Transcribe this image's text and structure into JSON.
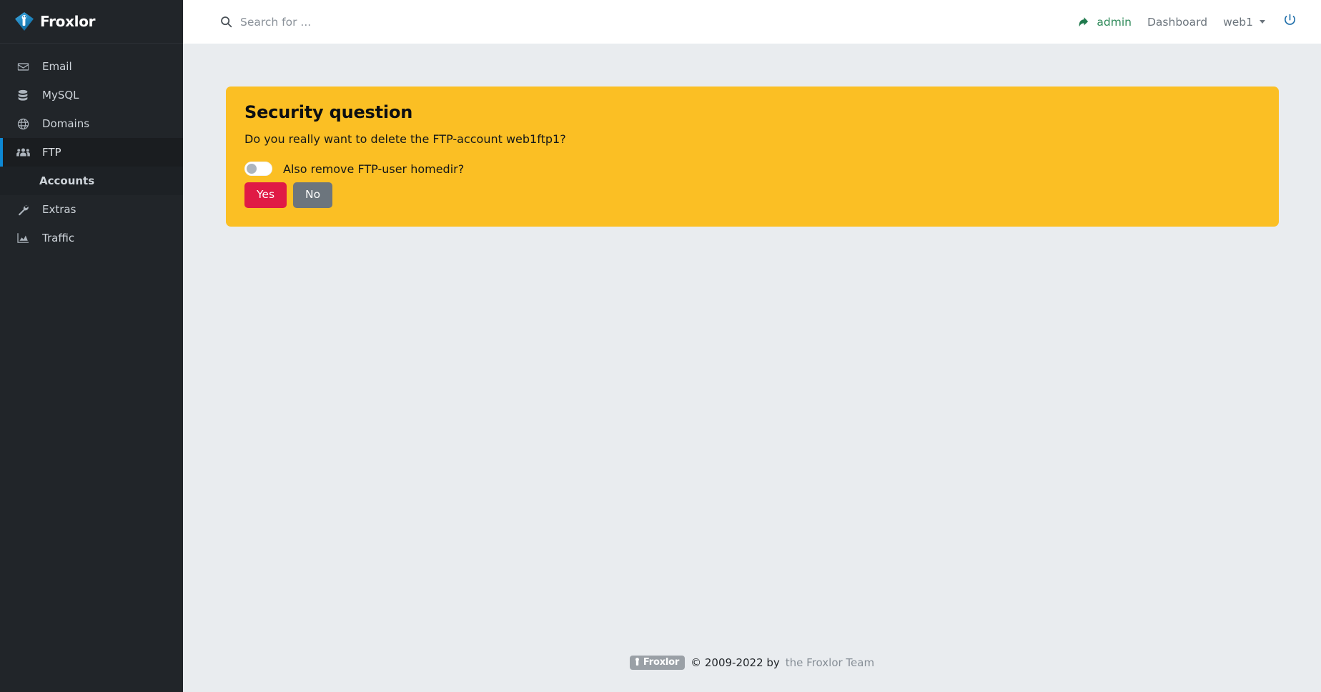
{
  "brand": {
    "name": "Froxlor",
    "logo_icon": "froxlor-wrench-logo",
    "accent_color": "#1b7fb8"
  },
  "sidebar": {
    "background_color": "#212529",
    "active_indicator_color": "#0d88d4",
    "items": [
      {
        "label": "Email",
        "icon": "envelope-icon",
        "active": false
      },
      {
        "label": "MySQL",
        "icon": "database-icon",
        "active": false
      },
      {
        "label": "Domains",
        "icon": "globe-icon",
        "active": false
      },
      {
        "label": "FTP",
        "icon": "users-icon",
        "active": true
      }
    ],
    "sub_item": {
      "label": "Accounts",
      "parent": "FTP"
    },
    "items_after": [
      {
        "label": "Extras",
        "icon": "wrench-icon",
        "active": false
      },
      {
        "label": "Traffic",
        "icon": "chart-icon",
        "active": false
      }
    ]
  },
  "topbar": {
    "search": {
      "icon": "search-icon",
      "placeholder": "Search for ...",
      "value": ""
    },
    "back_icon": "back-arrow-icon",
    "admin_label": "admin",
    "admin_color": "#2f8a5a",
    "dashboard_label": "Dashboard",
    "customer_label": "web1",
    "customer_caret_icon": "chevron-down-icon",
    "logout_icon": "power-icon",
    "logout_color": "#1b6ca8"
  },
  "panel": {
    "background_color": "#fbbf24",
    "title": "Security question",
    "question": "Do you really want to delete the FTP-account web1ftp1?",
    "toggle": {
      "label": "Also remove FTP-user homedir?",
      "state": "off",
      "knob_color": "#adb5bd",
      "track_color": "#ffffff"
    },
    "buttons": [
      {
        "label": "Yes",
        "color": "#e01a45",
        "name": "confirm-yes-button"
      },
      {
        "label": "No",
        "color": "#6c757d",
        "name": "confirm-no-button"
      }
    ]
  },
  "footer": {
    "badge_text": "Froxlor",
    "badge_icon": "froxlor-wrench-icon",
    "copyright": "© 2009-2022 by",
    "team_link": "the Froxlor Team"
  }
}
